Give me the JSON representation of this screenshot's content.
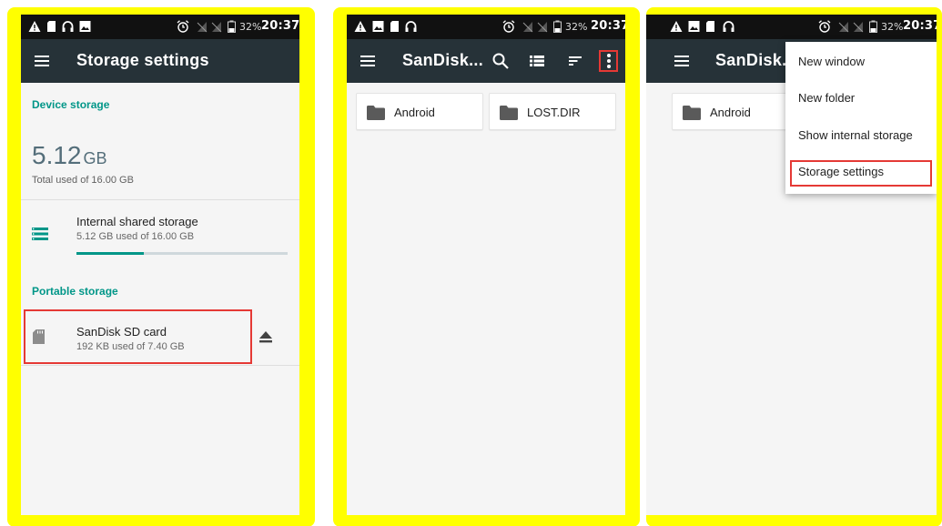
{
  "status_bar": {
    "time": "20:37",
    "battery": "32%",
    "left_icons": [
      "warning-icon",
      "sd-card-icon",
      "headset-icon",
      "image-icon"
    ],
    "right_icons": [
      "alarm-icon",
      "no-signal-icon",
      "no-signal-icon",
      "battery-icon"
    ]
  },
  "colors": {
    "frame": "#ffff00",
    "toolbar": "#263238",
    "accent": "#009688",
    "highlight": "#e53935"
  },
  "panel1": {
    "title": "Storage settings",
    "device_header": "Device storage",
    "device_total_value": "5.12",
    "device_total_unit": "GB",
    "device_total_caption": "Total used of 16.00 GB",
    "internal": {
      "title": "Internal shared storage",
      "subtitle": "5.12 GB used of 16.00 GB",
      "used_fraction": 0.32,
      "icon": "storage-list-icon"
    },
    "portable_header": "Portable storage",
    "sd_card": {
      "title": "SanDisk SD card",
      "subtitle": "192 KB used of 7.40 GB",
      "icon": "sd-card-icon",
      "action_icon": "eject-icon"
    }
  },
  "panel2": {
    "title": "SanDisk...",
    "toolbar_icons": [
      "search-icon",
      "list-view-icon",
      "sort-icon",
      "more-vert-icon"
    ],
    "folders": [
      {
        "name": "Android"
      },
      {
        "name": "LOST.DIR"
      }
    ]
  },
  "panel3": {
    "title": "SanDisk...",
    "visible_folder": "Android",
    "menu": [
      {
        "label": "New window"
      },
      {
        "label": "New folder"
      },
      {
        "label": "Show internal storage"
      },
      {
        "label": "Storage settings",
        "highlighted": true
      }
    ]
  }
}
